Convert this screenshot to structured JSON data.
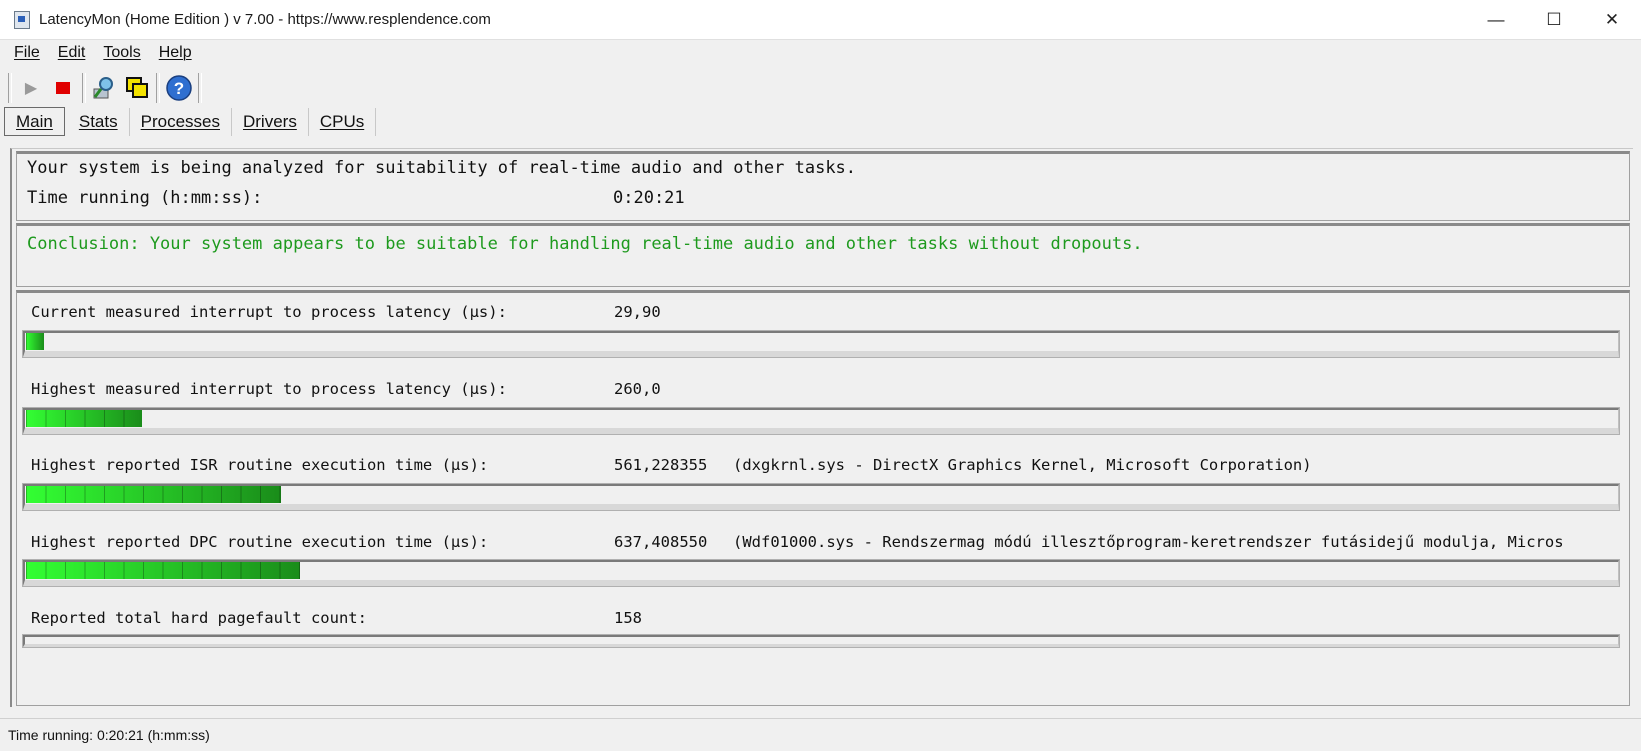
{
  "window": {
    "title": "LatencyMon  (Home Edition )  v 7.00 - https://www.resplendence.com",
    "minimize": "—",
    "maximize": "☐",
    "close": "✕"
  },
  "menu": [
    "File",
    "Edit",
    "Tools",
    "Help"
  ],
  "toolbar": {
    "play_icon": "▶",
    "stop_icon": "■",
    "help_icon": "?"
  },
  "tabs": [
    "Main",
    "Stats",
    "Processes",
    "Drivers",
    "CPUs"
  ],
  "status_panel": {
    "analyzing": "Your system is being analyzed for suitability of real-time audio and other tasks.",
    "time_label": "Time running (h:mm:ss):",
    "time_value": "0:20:21"
  },
  "conclusion": "Conclusion: Your system appears to be suitable for handling real-time audio and other tasks without dropouts.",
  "metrics": [
    {
      "label": "Current measured interrupt to process latency (µs):",
      "value": "29,90",
      "detail": "",
      "level": 0.011
    },
    {
      "label": "Highest measured interrupt to process latency (µs):",
      "value": "260,0",
      "detail": "",
      "level": 0.073
    },
    {
      "label": "Highest reported ISR routine execution time (µs):",
      "value": "561,228355",
      "detail": "(dxgkrnl.sys - DirectX Graphics Kernel, Microsoft Corporation)",
      "level": 0.16
    },
    {
      "label": "Highest reported DPC routine execution time (µs):",
      "value": "637,408550",
      "detail": "(Wdf01000.sys - Rendszermag módú illesztőprogram-keretrendszer futásidejű modulja, Micros",
      "level": 0.172
    },
    {
      "label": "Reported total hard pagefault count:",
      "value": "158",
      "detail": "",
      "level": 0
    }
  ],
  "statusbar": "Time running: 0:20:21  (h:mm:ss)",
  "colors": {
    "conclusion": "#1e9a1e",
    "bar_light": "#33ff33",
    "bar_dark": "#1a8c1a"
  }
}
